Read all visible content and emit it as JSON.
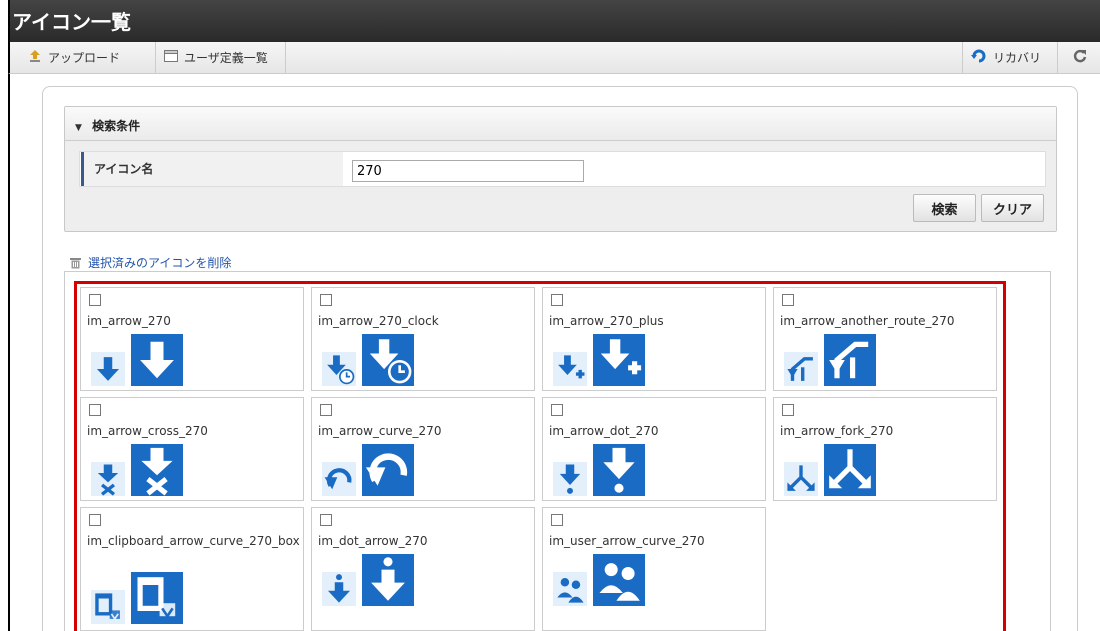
{
  "window": {
    "title": "アイコン一覧"
  },
  "toolbar": {
    "upload_label": "アップロード",
    "userdef_label": "ユーザ定義一覧",
    "recovery_label": "リカバリ",
    "refresh_icon": "refresh-icon"
  },
  "search": {
    "header": "検索条件",
    "field_label": "アイコン名",
    "field_value": "270",
    "search_button": "検索",
    "clear_button": "クリア"
  },
  "delete_link": "選択済みのアイコンを削除",
  "colors": {
    "accent": "#1a6bc4",
    "highlight_border": "#d40000",
    "titlebar": "#333333"
  },
  "icons": [
    {
      "name": "im_arrow_270",
      "glyph": "arrow-down",
      "checked": false
    },
    {
      "name": "im_arrow_270_clock",
      "glyph": "arrow-clock",
      "checked": false
    },
    {
      "name": "im_arrow_270_plus",
      "glyph": "arrow-plus",
      "checked": false
    },
    {
      "name": "im_arrow_another_route_270",
      "glyph": "another-route",
      "checked": false
    },
    {
      "name": "im_arrow_cross_270",
      "glyph": "arrow-cross",
      "checked": false
    },
    {
      "name": "im_arrow_curve_270",
      "glyph": "arrow-curve",
      "checked": false
    },
    {
      "name": "im_arrow_dot_270",
      "glyph": "arrow-dot",
      "checked": false
    },
    {
      "name": "im_arrow_fork_270",
      "glyph": "arrow-fork",
      "checked": false
    },
    {
      "name": "im_clipboard_arrow_curve_270_box",
      "glyph": "clipboard",
      "checked": false
    },
    {
      "name": "im_dot_arrow_270",
      "glyph": "dot-arrow",
      "checked": false
    },
    {
      "name": "im_user_arrow_curve_270",
      "glyph": "user-arrow",
      "checked": false
    }
  ]
}
